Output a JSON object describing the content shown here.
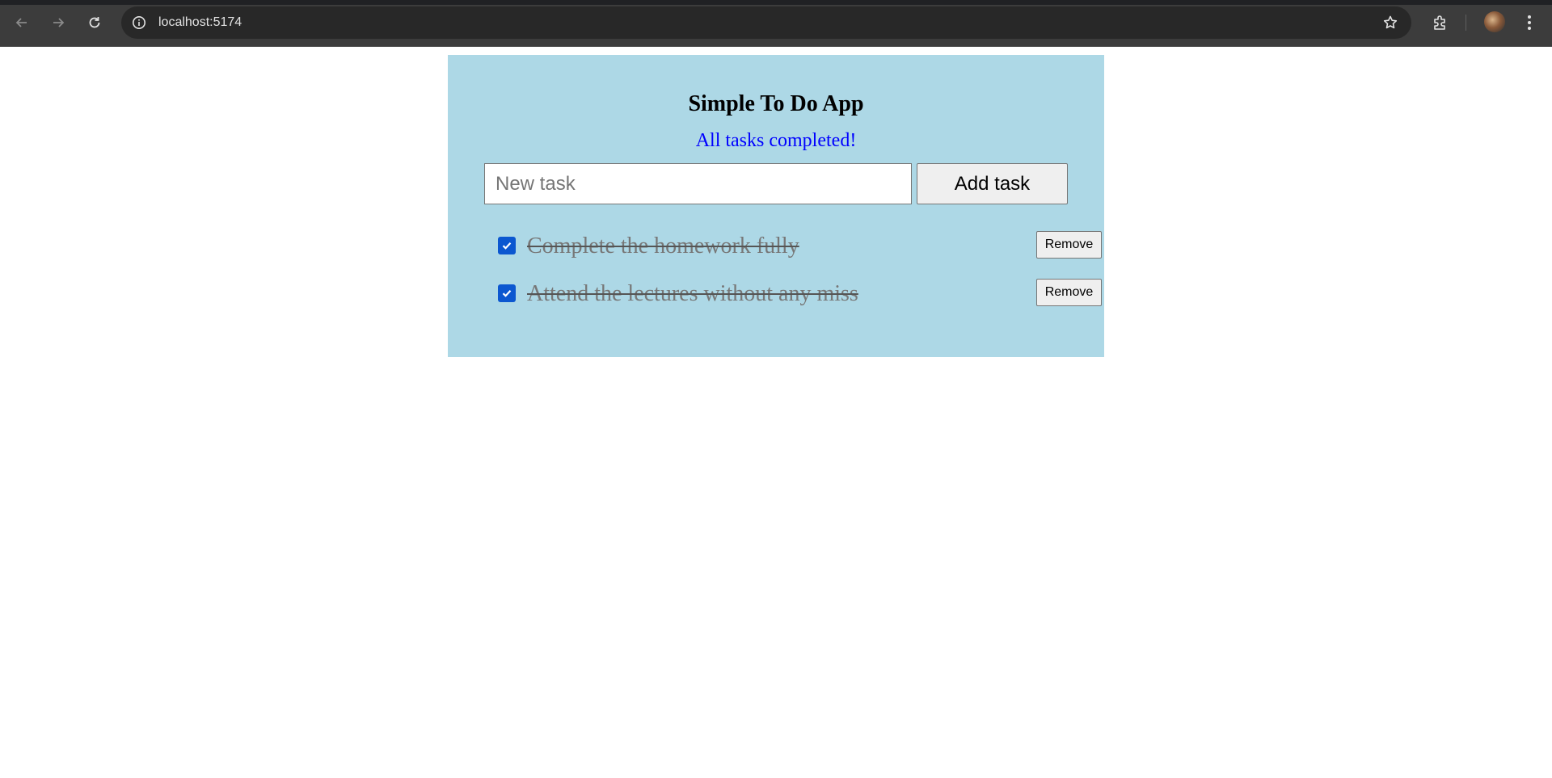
{
  "browser": {
    "url": "localhost:5174"
  },
  "app": {
    "title": "Simple To Do App",
    "status": "All tasks completed!",
    "status_color": "#0000ff",
    "background": "#add8e6",
    "input": {
      "placeholder": "New task",
      "value": ""
    },
    "add_label": "Add task",
    "tasks": [
      {
        "text": "Complete the homework fully",
        "completed": true,
        "remove_label": "Remove"
      },
      {
        "text": "Attend the lectures without any miss",
        "completed": true,
        "remove_label": "Remove"
      }
    ]
  }
}
